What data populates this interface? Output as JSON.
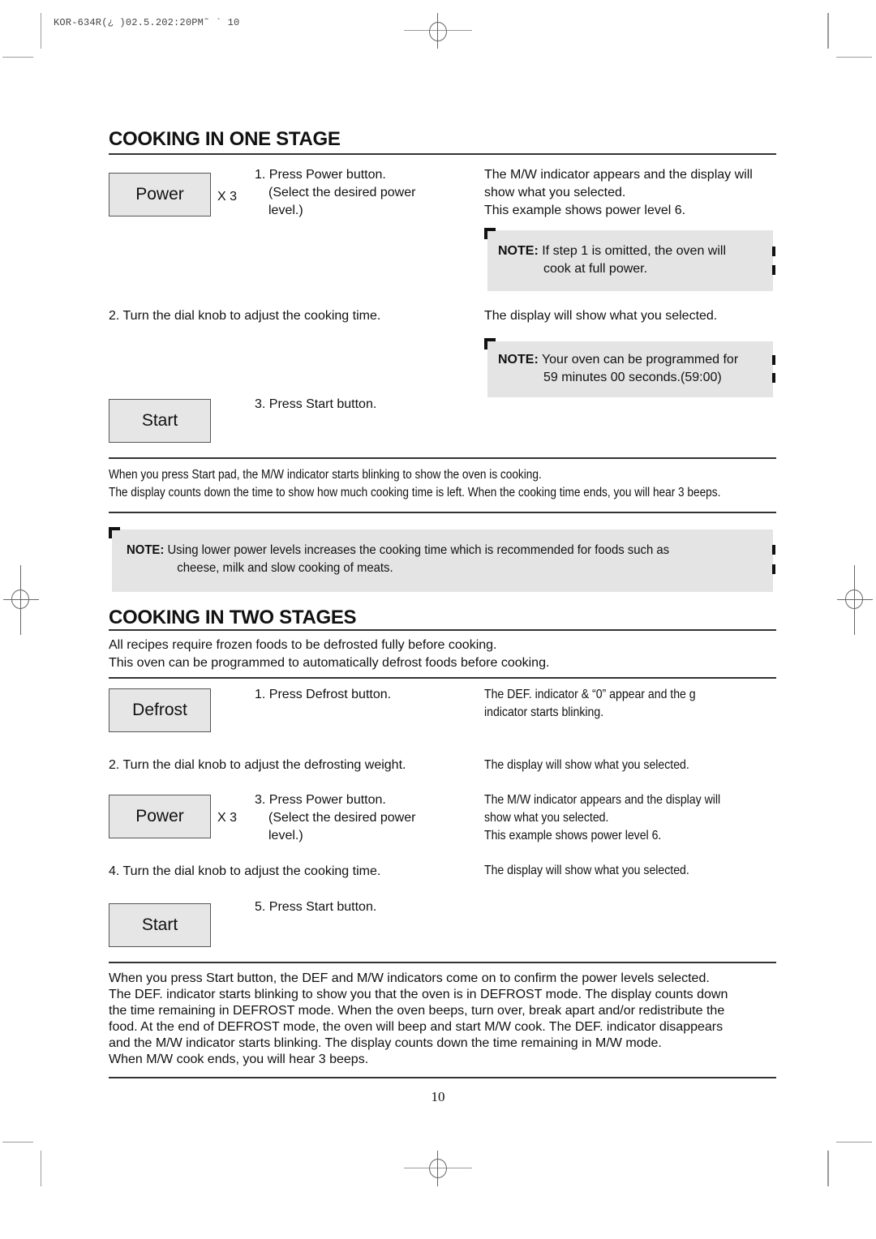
{
  "print_header": "KOR-634R(¿ )02.5.202:20PM˜  `  10",
  "section_one": {
    "title": "COOKING IN ONE STAGE",
    "steps": [
      {
        "button_label": "Power",
        "multiplier": "X 3",
        "instruction_lines": [
          "1. Press Power button.",
          "(Select the desired power",
          "level.)"
        ],
        "result_lines": [
          "The M/W indicator appears and the display will",
          "show what you selected.",
          "This example shows power level 6."
        ]
      },
      {
        "instruction_lines": [
          "2. Turn the dial knob to adjust the cooking time."
        ],
        "result_lines": [
          "The display will show what you selected."
        ]
      },
      {
        "button_label": "Start",
        "instruction_lines": [
          "3. Press Start button."
        ]
      }
    ],
    "notes": [
      {
        "label": "NOTE:",
        "lines": [
          "If step 1 is omitted, the oven will",
          "cook at full power."
        ]
      },
      {
        "label": "NOTE:",
        "lines": [
          "Your oven can be programmed for",
          "59 minutes 00 seconds.(59:00)"
        ]
      }
    ],
    "summary_lines": [
      "When you press Start pad, the M/W indicator starts blinking to show the oven is cooking.",
      "The display counts down the time to show how much cooking time is left. When the cooking time ends, you will hear 3 beeps."
    ],
    "bottom_note": {
      "label": "NOTE:",
      "lines": [
        "Using lower power levels increases the cooking time which is recommended for foods such as",
        "cheese, milk and slow cooking of meats."
      ]
    }
  },
  "section_two": {
    "title": "COOKING IN TWO STAGES",
    "intro_lines": [
      "All recipes require frozen foods to be defrosted fully before cooking.",
      "This oven can be programmed to automatically defrost foods before cooking."
    ],
    "steps": [
      {
        "button_label": "Defrost",
        "instruction_lines": [
          "1. Press Defrost button."
        ],
        "result_lines": [
          "The DEF. indicator & “0” appear and the g",
          "indicator starts blinking."
        ]
      },
      {
        "instruction_lines": [
          "2. Turn the dial knob to adjust the defrosting weight."
        ],
        "result_lines": [
          "The display will show what you selected."
        ]
      },
      {
        "button_label": "Power",
        "multiplier": "X 3",
        "instruction_lines": [
          "3. Press Power button.",
          "(Select the desired power",
          "level.)"
        ],
        "result_lines": [
          "The M/W indicator appears and the display will",
          "show what you selected.",
          "This example shows power level 6."
        ]
      },
      {
        "instruction_lines": [
          "4. Turn the dial knob to adjust the cooking time."
        ],
        "result_lines": [
          "The display will show what you selected."
        ]
      },
      {
        "button_label": "Start",
        "instruction_lines": [
          "5. Press Start button."
        ]
      }
    ],
    "summary_lines": [
      "When you press Start button, the DEF and M/W indicators come on to confirm the power levels selected.",
      "The DEF. indicator starts blinking to show you that the oven is in DEFROST mode. The display counts down",
      "the time remaining in DEFROST mode. When the oven beeps, turn over, break apart and/or redistribute the",
      "food. At the end of DEFROST mode, the oven will beep and start M/W cook. The DEF. indicator disappears",
      "and the M/W indicator starts blinking. The display counts down the time remaining in M/W mode.",
      "When M/W cook ends, you will hear 3 beeps."
    ]
  },
  "page_number": "10"
}
